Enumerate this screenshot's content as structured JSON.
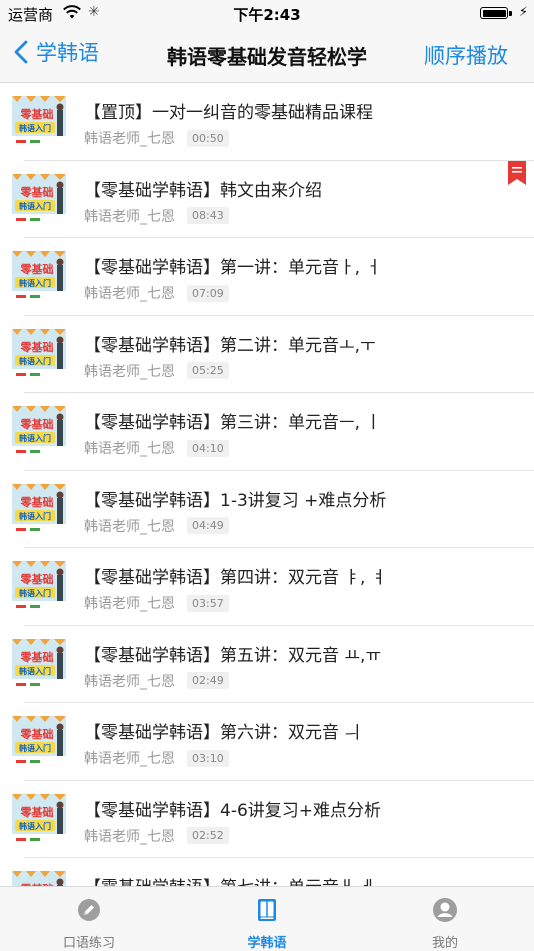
{
  "status_bar": {
    "carrier": "运营商",
    "time": "下午2:43"
  },
  "nav": {
    "back_label": "学韩语",
    "title": "韩语零基础发音轻松学",
    "right_label": "顺序播放"
  },
  "thumb": {
    "line1": "零基础",
    "line2": "韩语入门"
  },
  "lessons": [
    {
      "title": "【置顶】一对一纠音的零基础精品课程",
      "author": "韩语老师_七恩",
      "duration": "00:50"
    },
    {
      "title": "【零基础学韩语】韩文由来介绍",
      "author": "韩语老师_七恩",
      "duration": "08:43"
    },
    {
      "title": "【零基础学韩语】第一讲：单元音ㅏ, ㅓ",
      "author": "韩语老师_七恩",
      "duration": "07:09"
    },
    {
      "title": "【零基础学韩语】第二讲：单元音ㅗ,ㅜ",
      "author": "韩语老师_七恩",
      "duration": "05:25"
    },
    {
      "title": "【零基础学韩语】第三讲：单元音ㅡ, ㅣ",
      "author": "韩语老师_七恩",
      "duration": "04:10"
    },
    {
      "title": "【零基础学韩语】1-3讲复习 +难点分析",
      "author": "韩语老师_七恩",
      "duration": "04:49"
    },
    {
      "title": "【零基础学韩语】第四讲：双元音 ㅑ, ㅕ",
      "author": "韩语老师_七恩",
      "duration": "03:57"
    },
    {
      "title": "【零基础学韩语】第五讲：双元音 ㅛ,ㅠ",
      "author": "韩语老师_七恩",
      "duration": "02:49"
    },
    {
      "title": "【零基础学韩语】第六讲：双元音 ㅢ",
      "author": "韩语老师_七恩",
      "duration": "03:10"
    },
    {
      "title": "【零基础学韩语】4-6讲复习+难点分析",
      "author": "韩语老师_七恩",
      "duration": "02:52"
    },
    {
      "title": "【零基础学韩语】第七讲：单元音ㅐ,ㅔ",
      "author": "",
      "duration": ""
    }
  ],
  "tabs": [
    {
      "label": "口语练习"
    },
    {
      "label": "学韩语"
    },
    {
      "label": "我的"
    }
  ],
  "colors": {
    "accent": "#1e88e5",
    "bookmark": "#e53935"
  }
}
